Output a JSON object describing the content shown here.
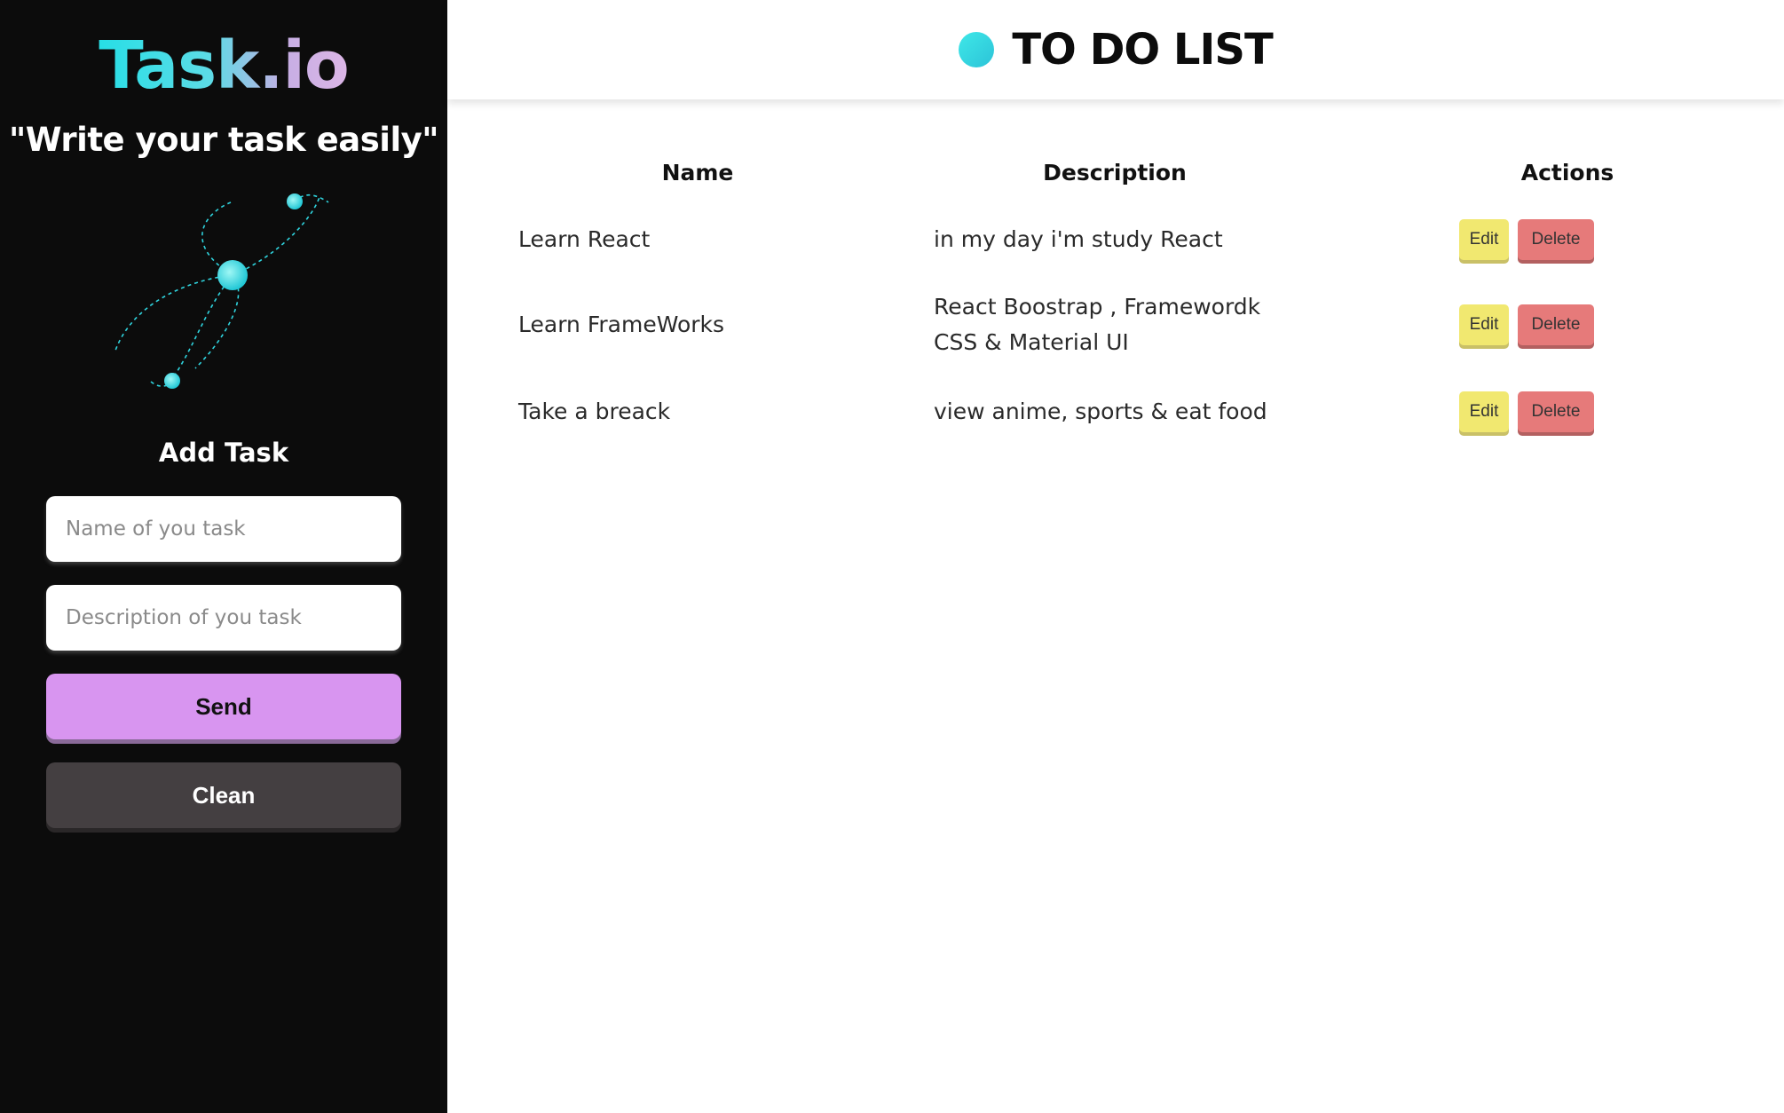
{
  "sidebar": {
    "brand": "Task.io",
    "tagline": "\"Write your task easily\"",
    "add_task_title": "Add Task",
    "name_placeholder": "Name of you task",
    "description_placeholder": "Description of you task",
    "send_label": "Send",
    "clean_label": "Clean"
  },
  "header": {
    "title": "TO DO LIST"
  },
  "table": {
    "headers": {
      "name": "Name",
      "description": "Description",
      "actions": "Actions"
    },
    "rows": [
      {
        "name": "Learn React",
        "description_lines": [
          "in my day i'm study React"
        ],
        "edit_label": "Edit",
        "delete_label": "Delete"
      },
      {
        "name": "Learn FrameWorks",
        "description_lines": [
          "React Boostrap , Framewordk",
          "CSS & Material UI"
        ],
        "edit_label": "Edit",
        "delete_label": "Delete"
      },
      {
        "name": "Take a breack",
        "description_lines": [
          "view anime, sports & eat food"
        ],
        "edit_label": "Edit",
        "delete_label": "Delete"
      }
    ]
  },
  "colors": {
    "sidebar_bg": "#0c0c0c",
    "brand_gradient_start": "#27dfe6",
    "brand_gradient_end": "#dcb6e6",
    "send_button": "#d895f0",
    "clean_button": "#443f41",
    "edit_button": "#f1e870",
    "delete_button": "#e67a7a",
    "accent_dot": "#3ee8e8"
  },
  "icons": {
    "illustration": "connected-dots-illustration",
    "header_dot": "gradient-circle-icon"
  }
}
